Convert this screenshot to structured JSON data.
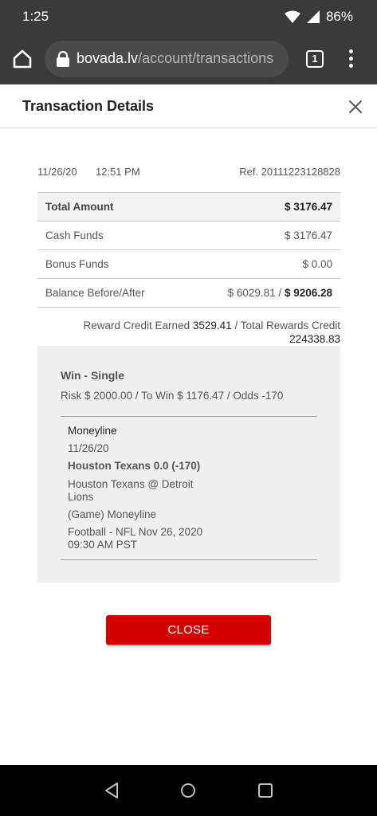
{
  "status_bar": {
    "time": "1:25",
    "battery": "86%"
  },
  "browser": {
    "url_domain": "bovada.lv",
    "url_path": "/account/transactions",
    "tab_count": "1"
  },
  "modal": {
    "title": "Transaction Details"
  },
  "transaction": {
    "date": "11/26/20",
    "time": "12:51 PM",
    "ref": "Ref. 20111223128828",
    "rows": [
      {
        "label": "Total Amount",
        "value": "$ 3176.47"
      },
      {
        "label": "Cash Funds",
        "value": "$ 3176.47"
      },
      {
        "label": "Bonus Funds",
        "value": "$ 0.00"
      },
      {
        "label": "Balance Before/After",
        "before": "$ 6029.81 /",
        "after": "$ 9206.28"
      }
    ],
    "rewards": {
      "earned_label": "Reward Credit Earned",
      "earned_value": "3529.41",
      "total_label": "/ Total Rewards Credit",
      "total_value": "224338.83"
    }
  },
  "bet": {
    "type": "Win - Single",
    "summary": "Risk $ 2000.00 / To Win $ 1176.47 / Odds -170",
    "leg": {
      "market": "Moneyline",
      "date": "11/26/20",
      "selection": "Houston Texans 0.0 (-170)",
      "matchup": "Houston Texans @ Detroit Lions",
      "game_type": "(Game) Moneyline",
      "event": "Football - NFL Nov 26, 2020 09:30 AM PST"
    }
  },
  "actions": {
    "close_label": "CLOSE"
  },
  "colors": {
    "accent": "#d50000",
    "chrome": "#3a3a3a"
  }
}
